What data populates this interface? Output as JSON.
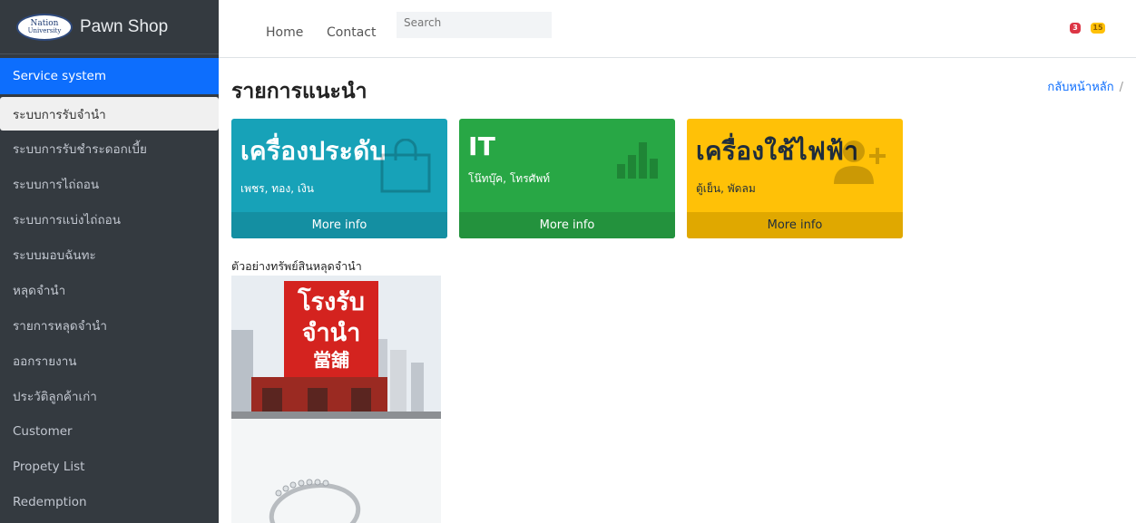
{
  "brand": {
    "logo_line1": "Nation",
    "logo_line2": "University",
    "name": "Pawn Shop"
  },
  "sidebar": {
    "header": "Service system",
    "items": [
      {
        "label": "ระบบการรับจำนำ",
        "active": true
      },
      {
        "label": "ระบบการรับชำระดอกเบี้ย"
      },
      {
        "label": "ระบบการไถ่ถอน"
      },
      {
        "label": "ระบบการแบ่งไถ่ถอน"
      },
      {
        "label": "ระบบมอบฉันทะ"
      },
      {
        "label": "หลุดจำนำ"
      },
      {
        "label": "รายการหลุดจำนำ"
      },
      {
        "label": "ออกรายงาน"
      },
      {
        "label": "ประวัติลูกค้าเก่า"
      },
      {
        "label": "Customer"
      },
      {
        "label": "Propety List"
      },
      {
        "label": "Redemption"
      }
    ]
  },
  "topnav": {
    "home": "Home",
    "contact": "Contact",
    "search_placeholder": "Search",
    "badge_red": "3",
    "badge_yellow": "15"
  },
  "content": {
    "title": "รายการแนะนำ",
    "breadcrumb": "กลับหน้าหลัก",
    "breadcrumb_sep": "/",
    "boxes": [
      {
        "title": "เครื่องประดับ",
        "subtitle": "เพชร, ทอง, เงิน",
        "footer": "More info",
        "color": "#17a2b8",
        "icon": "shopping-bag-icon"
      },
      {
        "title": "IT",
        "subtitle": "โน๊ทบุ๊ค, โทรศัพท์",
        "footer": "More info",
        "color": "#28a745",
        "icon": "bar-chart-icon"
      },
      {
        "title": "เครื่องใช้ไฟฟ้า",
        "subtitle": "ตู้เย็น, พัดลม",
        "footer": "More info",
        "color": "#ffc107",
        "icon": "user-plus-icon"
      }
    ],
    "section_label": "ตัวอย่างทรัพย์สินหลุดจำนำ",
    "sign_line1": "โรงรับ",
    "sign_line2": "จำนำ",
    "sign_line3": "當舖"
  }
}
